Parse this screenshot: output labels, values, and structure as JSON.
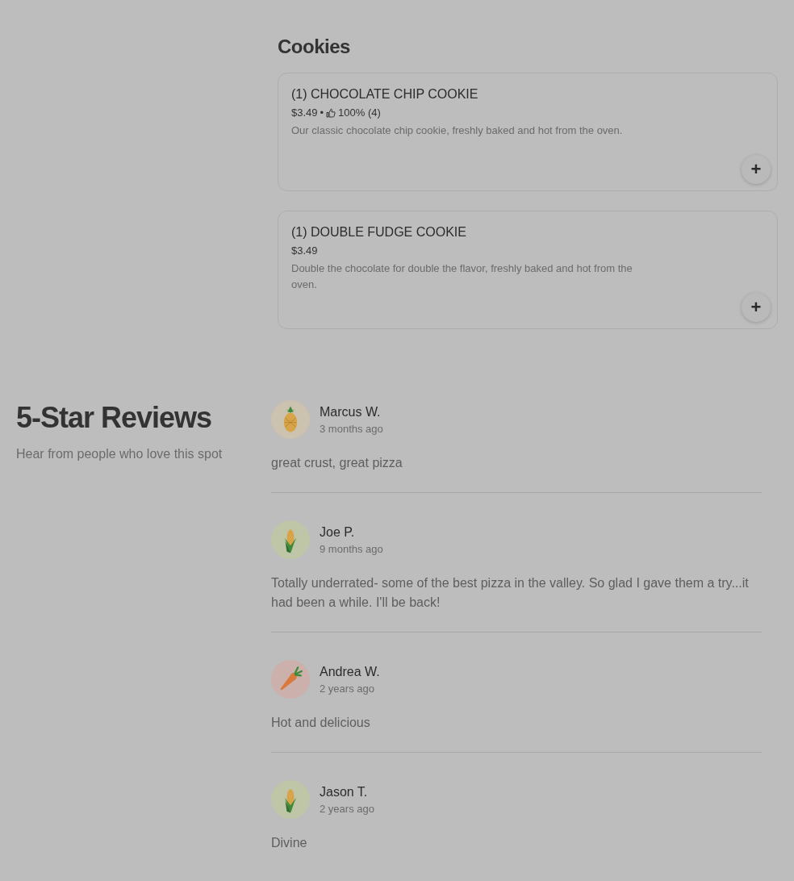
{
  "menu_section": {
    "title": "Cookies",
    "items": [
      {
        "name": "(1) CHOCOLATE CHIP COOKIE",
        "price": "$3.49",
        "separator": "•",
        "rating": "100% (4)",
        "description": "Our classic chocolate chip cookie, freshly baked and hot from the oven.",
        "add_label": "+"
      },
      {
        "name": "(1) DOUBLE FUDGE COOKIE",
        "price": "$3.49",
        "description": "Double the chocolate for double the flavor, freshly baked and hot from the oven.",
        "add_label": "+"
      }
    ]
  },
  "reviews_section": {
    "title": "5-Star Reviews",
    "subtitle": "Hear from people who love this spot",
    "reviews": [
      {
        "kind": "pineapple",
        "color": "#cbc3b0",
        "name": "Marcus W.",
        "time": "3 months ago",
        "text": "great crust, great pizza"
      },
      {
        "kind": "corn",
        "color": "#bfc6a8",
        "name": "Joe P.",
        "time": "9 months ago",
        "text": "Totally underrated- some of the best pizza in the valley. So glad I gave them a try...it had been a while. I'll be back!"
      },
      {
        "kind": "carrot",
        "color": "#cbb0ac",
        "name": "Andrea W.",
        "time": "2 years ago",
        "text": "Hot and delicious"
      },
      {
        "kind": "corn",
        "color": "#bfc6a8",
        "name": "Jason T.",
        "time": "2 years ago",
        "text": "Divine"
      }
    ]
  }
}
